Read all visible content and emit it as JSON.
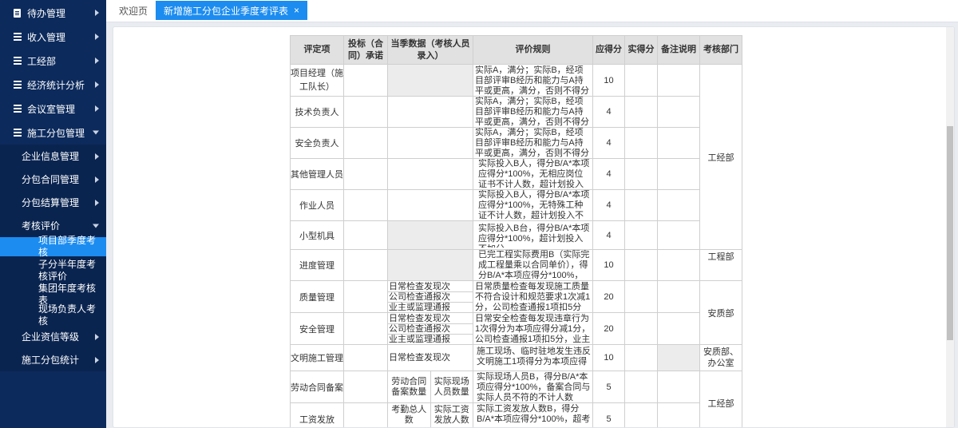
{
  "sidebar": {
    "items": [
      {
        "label": "待办管理",
        "icon": "document-icon"
      },
      {
        "label": "收入管理",
        "icon": "grid-icon"
      },
      {
        "label": "工经部",
        "icon": "grid-icon"
      },
      {
        "label": "经济统计分析",
        "icon": "grid-icon"
      },
      {
        "label": "会议室管理",
        "icon": "grid-icon"
      },
      {
        "label": "施工分包管理",
        "icon": "grid-icon"
      }
    ],
    "sub_items": [
      {
        "label": "企业信息管理"
      },
      {
        "label": "分包合同管理"
      },
      {
        "label": "分包结算管理"
      },
      {
        "label": "考核评价"
      }
    ],
    "leaf_items": [
      {
        "label": "项目部季度考核"
      },
      {
        "label": "子分半年度考核评价"
      },
      {
        "label": "集团年度考核表"
      },
      {
        "label": "现场负责人考核"
      }
    ],
    "tail_items": [
      {
        "label": "企业资信等级"
      },
      {
        "label": "施工分包统计"
      }
    ]
  },
  "tabs": [
    {
      "label": "欢迎页"
    },
    {
      "label": "新增施工分包企业季度考评表",
      "close": "×"
    }
  ],
  "table": {
    "headers": [
      "评定项",
      "投标（合同）承诺",
      "当季数据（考核人员录入）",
      "评价规则",
      "应得分",
      "实得分",
      "备注说明",
      "考核部门"
    ],
    "rows": [
      {
        "item": "项目经理（施工队长）",
        "rule": "实际A，满分；实际B，经项目部评审B经历和能力与A持平或更高，满分，否则不得分",
        "score": "10"
      },
      {
        "item": "技术负责人",
        "rule": "实际A，满分；实际B，经项目部评审B经历和能力与A持平或更高，满分，否则不得分",
        "score": "4"
      },
      {
        "item": "安全负责人",
        "rule": "实际A，满分；实际B，经项目部评审B经历和能力与A持平或更高，满分，否则不得分",
        "score": "4"
      },
      {
        "item": "其他管理人员",
        "rule": "实际投入B人，得分B/A*本项应得分*100%，无相应岗位证书不计人数，超计划投入不加分",
        "score": "4"
      },
      {
        "item": "作业人员",
        "rule": "实际投入B人，得分B/A*本项应得分*100%，无特殊工种证不计人数，超计划投入不加分",
        "score": "4"
      },
      {
        "item": "小型机具",
        "rule": "实际投入B台，得分B/A*本项应得分*100%，超计划投入不加分",
        "score": "4"
      },
      {
        "item": "进度管理",
        "rule": "已完工程实际费用B（实际完成工程量乘以合同单价），得分B/A*本项应得分*100%，超",
        "score": "10"
      },
      {
        "item": "质量管理",
        "sub": [
          "日常检查发现次",
          "公司检查通报次",
          "业主或监理通报"
        ],
        "rule": "日常质量检查每发现施工质量不符合设计和规范要求1次减1分，公司检查通报1项扣5分",
        "score": "20"
      },
      {
        "item": "安全管理",
        "sub": [
          "日常检查发现次",
          "公司检查通报次",
          "业主或监理通报"
        ],
        "rule": "日常安全检查每发现违章行为1次得分为本项应得分减1分，公司检查通报1项扣5分，业主",
        "score": "20"
      },
      {
        "item": "文明施工管理",
        "sub": [
          "日常检查发现次"
        ],
        "rule": "施工现场、临时驻地发生违反文明施工1项得分为本项应得",
        "score": "10"
      },
      {
        "item": "劳动合同备案",
        "split": [
          "劳动合同备案数量",
          "实际现场人员数量"
        ],
        "rule": "实际现场人员B，得分B/A*本项应得分*100%，备案合同与实际人员不符的不计人数",
        "score": "5"
      },
      {
        "item": "工资发放",
        "split": [
          "考勤总人数",
          "实际工资发放人数"
        ],
        "rule": "实际工资发放人数B，得分B/A*本项应得分*100%，超考",
        "score": "5"
      }
    ],
    "departments": [
      "工经部",
      "工程部",
      "安质部",
      "安质部、办公室",
      "工经部"
    ]
  },
  "colors": {
    "sidebar_bg": "#0c2a5c",
    "accent": "#1c8cf0",
    "header_bg": "#e1e1e1"
  }
}
